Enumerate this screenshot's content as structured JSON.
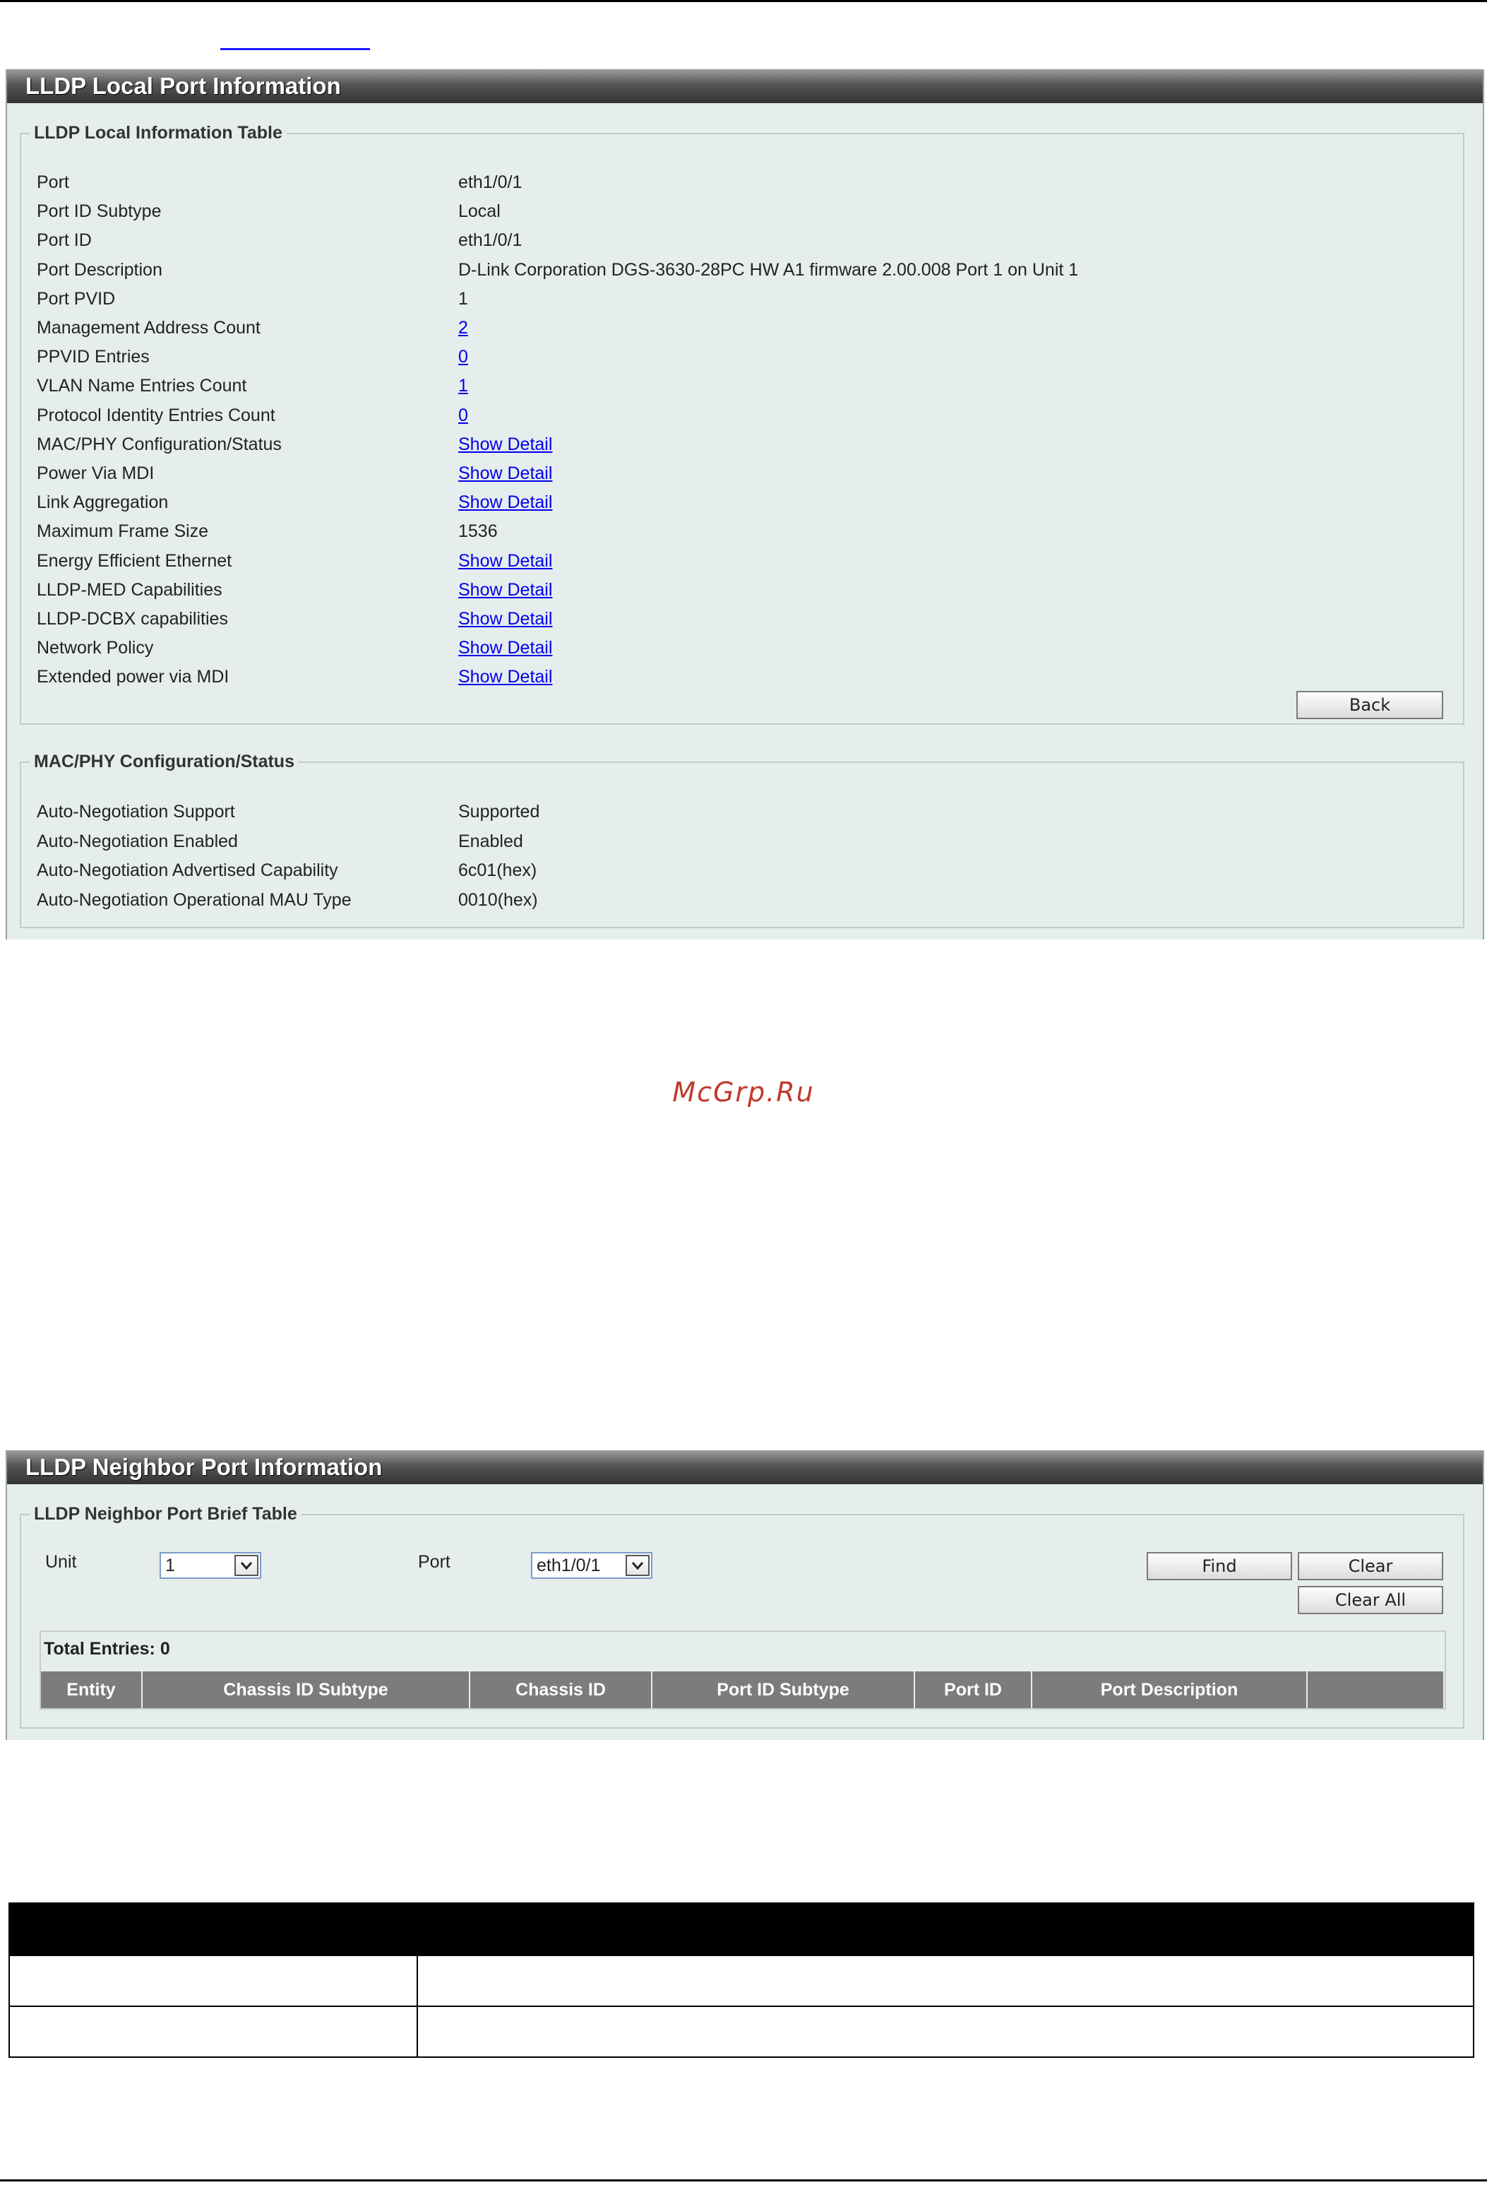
{
  "local": {
    "title": "LLDP Local Port Information",
    "table_legend": "LLDP Local Information Table",
    "rows": [
      {
        "label": "Port",
        "value": "eth1/0/1"
      },
      {
        "label": "Port ID Subtype",
        "value": "Local"
      },
      {
        "label": "Port ID",
        "value": "eth1/0/1"
      },
      {
        "label": "Port Description",
        "value": "D-Link Corporation DGS-3630-28PC HW A1 firmware 2.00.008 Port 1 on Unit 1"
      },
      {
        "label": "Port PVID",
        "value": "1"
      },
      {
        "label": "Management Address Count",
        "value": "2"
      },
      {
        "label": "PPVID Entries",
        "value": "0"
      },
      {
        "label": "VLAN Name Entries Count",
        "value": "1"
      },
      {
        "label": "Protocol Identity Entries Count",
        "value": "0"
      },
      {
        "label": "MAC/PHY Configuration/Status",
        "value": "Show Detail"
      },
      {
        "label": "Power Via MDI",
        "value": "Show Detail"
      },
      {
        "label": "Link Aggregation",
        "value": "Show Detail"
      },
      {
        "label": "Maximum Frame Size",
        "value": "1536"
      },
      {
        "label": "Energy Efficient Ethernet",
        "value": "Show Detail"
      },
      {
        "label": "LLDP-MED Capabilities",
        "value": "Show Detail"
      },
      {
        "label": "LLDP-DCBX capabilities",
        "value": "Show Detail"
      },
      {
        "label": "Network Policy",
        "value": "Show Detail"
      },
      {
        "label": "Extended power via MDI",
        "value": "Show Detail"
      }
    ],
    "back_label": "Back",
    "macphy_legend": "MAC/PHY Configuration/Status",
    "macphy_rows": [
      {
        "label": "Auto-Negotiation Support",
        "value": "Supported"
      },
      {
        "label": "Auto-Negotiation Enabled",
        "value": "Enabled"
      },
      {
        "label": "Auto-Negotiation Advertised Capability",
        "value": "6c01(hex)"
      },
      {
        "label": "Auto-Negotiation Operational MAU Type",
        "value": "0010(hex)"
      }
    ]
  },
  "watermark": "McGrp.Ru",
  "neighbor": {
    "title": "LLDP Neighbor Port Information",
    "legend": "LLDP Neighbor Port Brief Table",
    "unit_label": "Unit",
    "unit_value": "1",
    "port_label": "Port",
    "port_value": "eth1/0/1",
    "find_label": "Find",
    "clear_label": "Clear",
    "clear_all_label": "Clear All",
    "total_entries": "Total Entries: 0",
    "columns": [
      "Entity",
      "Chassis ID Subtype",
      "Chassis ID",
      "Port ID Subtype",
      "Port ID",
      "Port Description",
      ""
    ]
  }
}
